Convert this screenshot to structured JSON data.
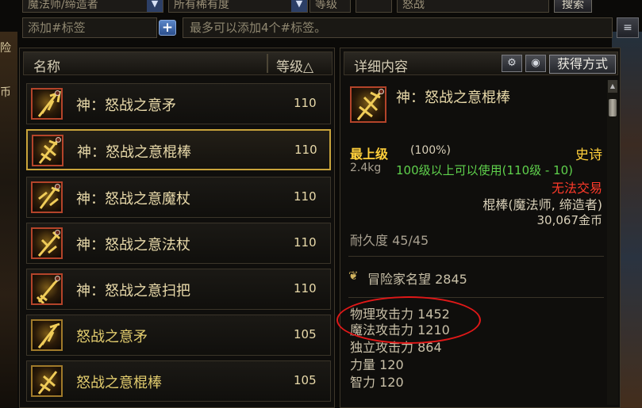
{
  "filters": {
    "job": "魔法师/缔造者",
    "rarity": "所有稀有度",
    "level_label": "等级",
    "keyword": "怒战",
    "search_btn": "搜索"
  },
  "tags": {
    "input_placeholder": "添加#标签",
    "add_btn": "+",
    "hint": "最多可以添加4个#标签。",
    "menu_icon": "≡"
  },
  "list": {
    "col_name": "名称",
    "col_level": "等级△",
    "items": [
      {
        "name": "神：怒战之意矛",
        "level": "110"
      },
      {
        "name": "神：怒战之意棍棒",
        "level": "110"
      },
      {
        "name": "神：怒战之意魔杖",
        "level": "110"
      },
      {
        "name": "神：怒战之意法杖",
        "level": "110"
      },
      {
        "name": "神：怒战之意扫把",
        "level": "110"
      },
      {
        "name": "怒战之意矛",
        "level": "105"
      },
      {
        "name": "怒战之意棍棒",
        "level": "105"
      }
    ]
  },
  "detail": {
    "title": "详细内容",
    "obtain_btn": "获得方式",
    "item_name": "神：怒战之意棍棒",
    "grade": "最上级",
    "grade_pct": "(100%)",
    "rarity": "史诗",
    "weight": "2.4kg",
    "requirement": "100级以上可以使用(110级 - 10)",
    "trade": "无法交易",
    "type": "棍棒(魔法师, 缔造者)",
    "price": "30,067金币",
    "durability": "耐久度 45/45",
    "fame_label": "冒险家名望",
    "fame_value": "2845",
    "stats": [
      "物理攻击力 1452",
      "魔法攻击力 1210",
      "独立攻击力 864",
      "力量 120",
      "智力 120"
    ]
  },
  "colors": {
    "rarity_epic": "#ffcf3b",
    "requirement": "#5fd14c",
    "no_trade": "#ff3a2a",
    "selected_border": "#c9a43b",
    "highlight_ellipse": "#e01818"
  }
}
